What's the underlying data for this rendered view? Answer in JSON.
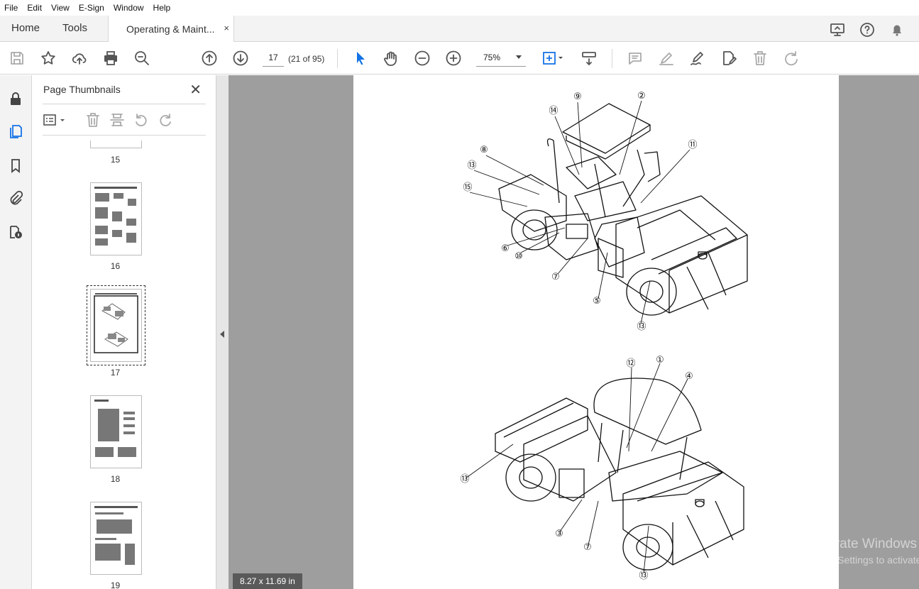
{
  "menu": [
    "File",
    "Edit",
    "View",
    "E-Sign",
    "Window",
    "Help"
  ],
  "tabs": {
    "home": "Home",
    "tools": "Tools",
    "document": "Operating & Maint...",
    "close": "×"
  },
  "toolbar": {
    "page_number": "17",
    "page_count": "(21 of 95)",
    "zoom": "75%"
  },
  "panel": {
    "title": "Page Thumbnails",
    "close": "✕",
    "thumbnails": [
      {
        "label": "15"
      },
      {
        "label": "16"
      },
      {
        "label": "17"
      },
      {
        "label": "18"
      },
      {
        "label": "19"
      }
    ]
  },
  "status": {
    "page_size": "8.27 x 11.69 in"
  },
  "watermark": {
    "line1": "Activate Windows",
    "line2": "Go to Settings to activate Windows."
  },
  "diagram": {
    "callouts_top": [
      "⑨",
      "②",
      "⑭",
      "⑪",
      "⑧",
      "⑬",
      "⑮",
      "⑥",
      "⑩",
      "⑦",
      "⑤",
      "⑬"
    ],
    "callouts_bottom": [
      "⑫",
      "①",
      "④",
      "⑬",
      "③",
      "⑦",
      "⑬"
    ]
  }
}
